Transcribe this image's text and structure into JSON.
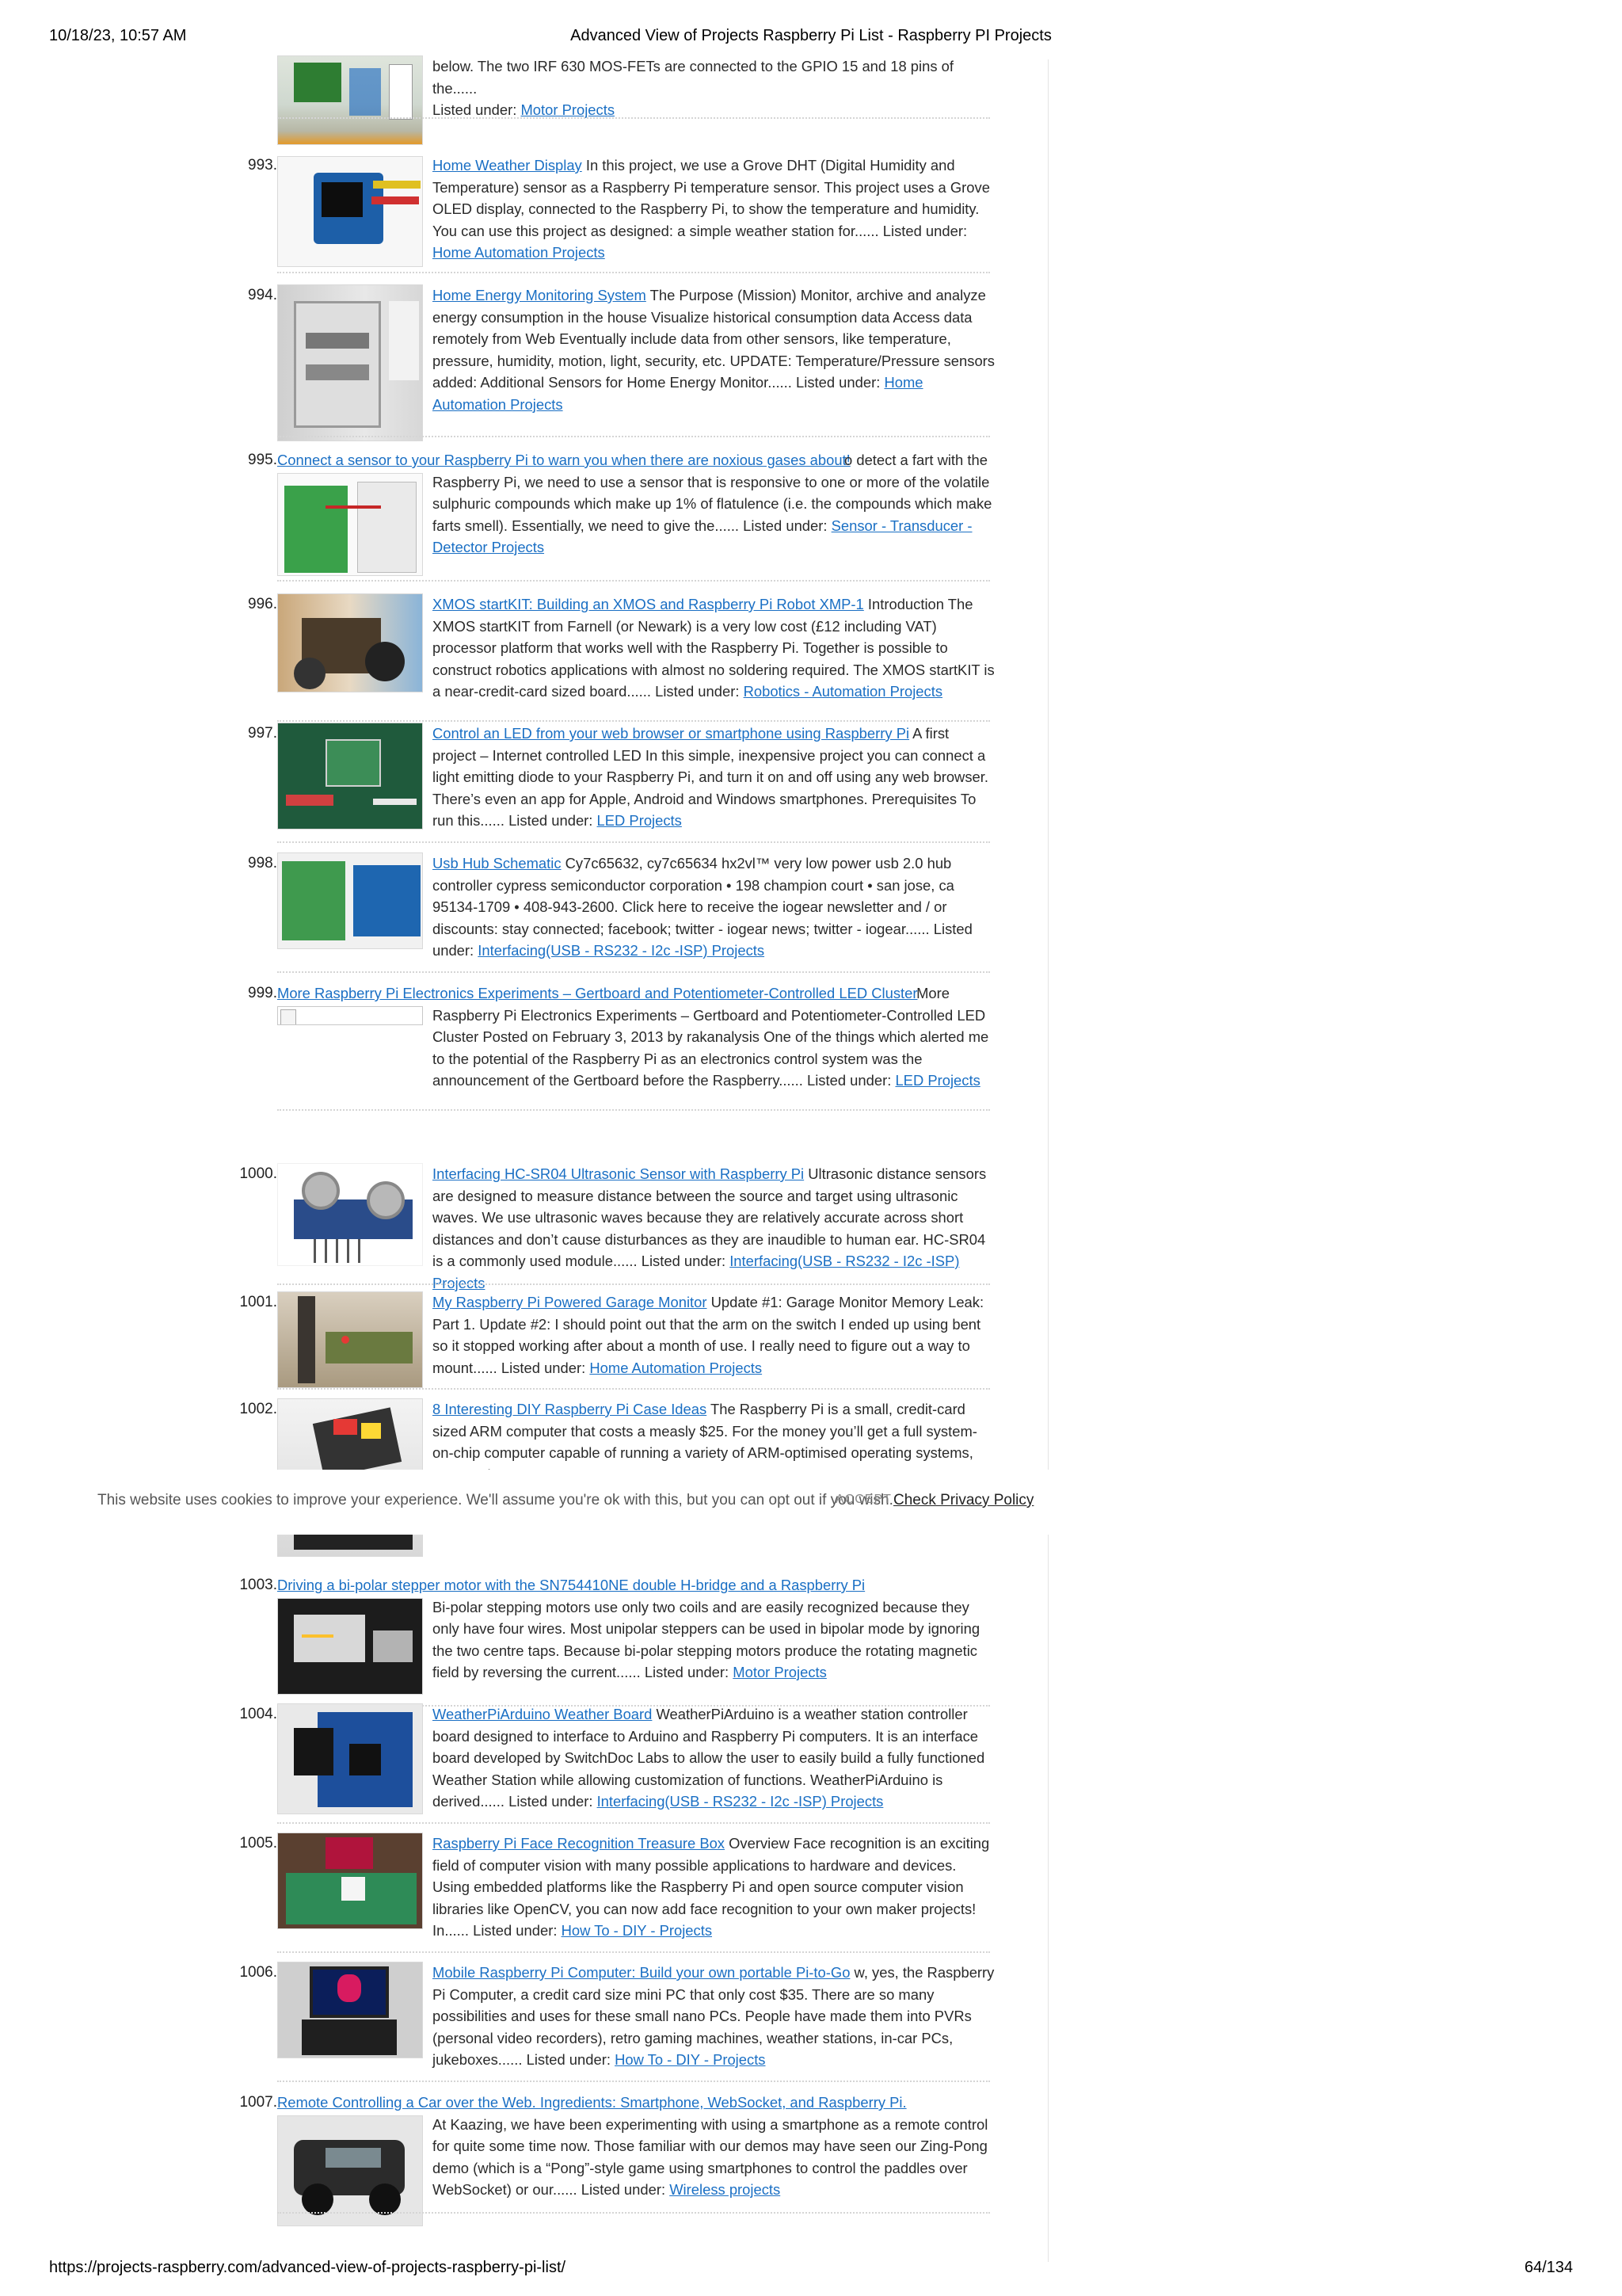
{
  "print_header": {
    "datetime": "10/18/23, 10:57 AM",
    "title": "Advanced View of Projects Raspberry Pi List - Raspberry PI Projects"
  },
  "print_footer": {
    "url": "https://projects-raspberry.com/advanced-view-of-projects-raspberry-pi-list/",
    "page": "64/134"
  },
  "listed_under": "Listed under:",
  "top_partial": {
    "text": "below. The two IRF 630 MOS-FETs are connected to the GPIO 15 and 18 pins of the......",
    "category": "Motor Projects"
  },
  "items": [
    {
      "num": "993.",
      "title": "Home Weather Display",
      "text": " In this project, we use a Grove DHT (Digital Humidity and Temperature) sensor as a Raspberry Pi temperature sensor.  This project uses a Grove OLED display, connected to the Raspberry Pi, to show the temperature and humidity.  You can use this project as designed: a simple weather station for...... ",
      "category": "Home Automation Projects"
    },
    {
      "num": "994.",
      "title": "Home Energy Monitoring System",
      "text": " The Purpose (Mission) Monitor, archive and analyze energy consumption in the house Visualize historical consumption data Access data remotely from Web Eventually include data from other sensors, like temperature, pressure, humidity, motion, light, security, etc. UPDATE: Temperature/Pressure sensors added: Additional Sensors for Home Energy Monitor...... ",
      "category": "Home Automation Projects"
    },
    {
      "num": "995.",
      "title": "Connect a sensor to your Raspberry Pi to warn you when there are noxious gases about!",
      "text": " o detect a fart with the Raspberry Pi, we need to use a sensor that is responsive to one or more of the volatile sulphuric compounds which make up 1% of flatulence (i.e. the compounds which make farts smell). Essentially, we need to give the...... ",
      "category": "Sensor - Transducer - Detector Projects"
    },
    {
      "num": "996.",
      "title": "XMOS startKIT: Building an XMOS and Raspberry Pi Robot XMP-1",
      "text": " Introduction The XMOS startKIT from Farnell (or Newark) is a very low cost (£12 including VAT) processor platform that works well with the Raspberry Pi. Together is possible to construct robotics applications with almost no soldering required. The XMOS startKIT is a near-credit-card sized board...... ",
      "category": "Robotics - Automation Projects"
    },
    {
      "num": "997.",
      "title": "Control an LED from your web browser or smartphone using Raspberry Pi",
      "text": " A first project – Internet controlled LED In this simple, inexpensive project you can connect a light emitting diode to your Raspberry Pi, and turn it on and off using any web browser. There’s even an app for Apple, Android and Windows smartphones. Prerequisites To run this...... ",
      "category": "LED Projects"
    },
    {
      "num": "998.",
      "title": "Usb Hub Schematic",
      "text": " Cy7c65632, cy7c65634 hx2vl™ very low power usb 2.0 hub controller cypress semiconductor corporation • 198 champion court • san jose, ca 95134-1709 • 408-943-2600. Click here to receive the iogear newsletter and / or discounts: stay connected; facebook; twitter - iogear news; twitter - iogear...... ",
      "category": "Interfacing(USB - RS232 - I2c -ISP) Projects"
    },
    {
      "num": "999.",
      "title": "More Raspberry Pi Electronics Experiments – Gertboard and Potentiometer-Controlled LED Cluster",
      "text": " More Raspberry Pi Electronics Experiments – Gertboard and Potentiometer-Controlled LED Cluster Posted on February 3, 2013 by rakanalysis One of the things which alerted me to the potential of the Raspberry Pi as an electronics control system was the announcement of the Gertboard before the Raspberry...... ",
      "category": "LED Projects"
    },
    {
      "num": "1000.",
      "title": "Interfacing HC-SR04 Ultrasonic Sensor with Raspberry Pi",
      "text": " Ultrasonic distance sensors are designed to measure distance between the source and target using ultrasonic waves. We use ultrasonic waves because they are relatively accurate across short distances and don’t cause disturbances as they are inaudible to human ear. HC-SR04 is a commonly used module...... ",
      "category": "Interfacing(USB - RS232 - I2c -ISP) Projects"
    },
    {
      "num": "1001.",
      "title": "My Raspberry Pi Powered Garage Monitor",
      "text": " Update #1: Garage Monitor Memory Leak: Part 1. Update #2: I should point out that the arm on the switch I ended up using bent so it stopped working after about a month of use. I really need to figure out a way to mount...... ",
      "category": "Home Automation Projects"
    },
    {
      "num": "1002.",
      "title": "8 Interesting DIY Raspberry Pi Case Ideas",
      "text": " The Raspberry Pi is a small, credit-card sized ARM computer that costs a measly $25. For the money you’ll get a full system-on-chip computer capable of running a variety of ARM-optimised operating systems, USB and",
      "category": ""
    },
    {
      "num": "1003.",
      "title": "Driving a bi-polar stepper motor with the SN754410NE double H-bridge and a Raspberry Pi",
      "text": " Bi-polar stepping motors use only two coils and are easily recognized because they only have four wires. Most unipolar steppers can be used in bipolar mode by ignoring the two centre taps. Because bi-polar stepping motors produce the rotating magnetic field by reversing the current...... ",
      "category": "Motor Projects"
    },
    {
      "num": "1004.",
      "title": "WeatherPiArduino Weather Board",
      "text": " WeatherPiArduino is a weather station controller board designed to interface to Arduino and Raspberry Pi computers.  It is an interface board developed by SwitchDoc Labs to allow the user to easily build a fully functioned Weather Station while allowing customization of functions. WeatherPiArduino is derived...... ",
      "category": "Interfacing(USB - RS232 - I2c -ISP) Projects"
    },
    {
      "num": "1005.",
      "title": "Raspberry Pi Face Recognition Treasure Box",
      "text": " Overview Face recognition is an exciting field of computer vision with many possible applications to hardware and devices. Using embedded platforms like the Raspberry Pi and open source computer vision libraries like OpenCV, you can now add face recognition to your own maker projects! In...... ",
      "category": "How To - DIY - Projects"
    },
    {
      "num": "1006.",
      "title": "Mobile Raspberry Pi Computer: Build your own portable Pi-to-Go",
      "text": " w, yes, the Raspberry Pi Computer, a credit card size mini PC that only cost $35. There are so many possibilities and uses for these small nano PCs. People have made them into PVRs (personal video recorders), retro gaming machines, weather stations, in-car PCs, jukeboxes...... ",
      "category": "How To - DIY - Projects"
    },
    {
      "num": "1007.",
      "title": "Remote Controlling a Car over the Web. Ingredients: Smartphone, WebSocket, and Raspberry Pi.",
      "text": " At Kaazing, we have been experimenting with using a smartphone as a remote control for quite some time now. Those familiar with our demos may have seen our Zing-Pong demo (which is a “Pong”-style game using smartphones to control the paddles over WebSocket) or our...... ",
      "category": "Wireless projects"
    }
  ],
  "cookie_bar": {
    "message": "This website uses cookies to improve your experience. We'll assume you're ok with this, but you can opt out if you wish.",
    "accept": "ACCEPT",
    "policy": "Check Privacy Policy"
  }
}
